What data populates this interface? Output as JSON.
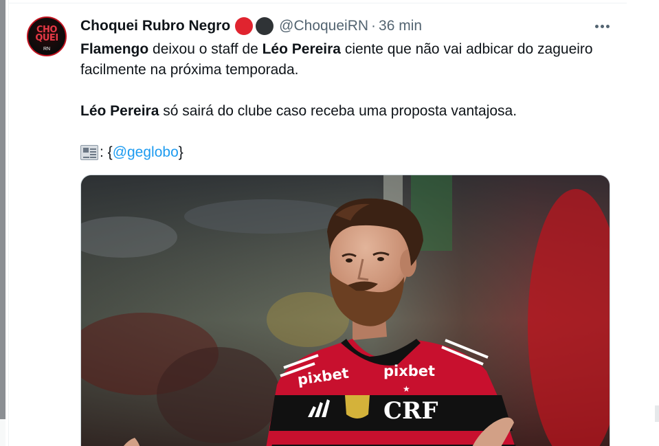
{
  "tweet": {
    "display_name": "Choquei Rubro Negro",
    "handle": "@ChoqueiRN",
    "separator": "·",
    "time": "36 min",
    "avatar": {
      "text_line1": "CHO",
      "text_line2": "QUEI",
      "text_sub": "RN"
    },
    "badges": [
      "red-circle-emoji",
      "black-circle-emoji"
    ],
    "body": {
      "p1": {
        "b1": "Flamengo",
        "t1": " deixou o staff de ",
        "b2": "Léo Pereira",
        "t2": " ciente que não vai adbicar do zagueiro facilmente na próxima temporada."
      },
      "p2": {
        "b1": "Léo Pereira",
        "t1": " só sairá do clube caso receba uma proposta vantajosa."
      },
      "p3": {
        "icon": "newspaper-icon",
        "prefix": ": {",
        "mention": "@geglobo",
        "suffix": "}"
      }
    },
    "media": {
      "kind": "photo",
      "jersey_sponsor_left": "pixbet",
      "jersey_sponsor_right": "pixbet",
      "jersey_crest": "CRF"
    }
  },
  "colors": {
    "accent_link": "#1d9bf0",
    "secondary_text": "#536471",
    "badge_red": "#e0242f",
    "badge_black": "#2f3336",
    "jersey_red": "#c8102e",
    "jersey_black": "#111111"
  }
}
